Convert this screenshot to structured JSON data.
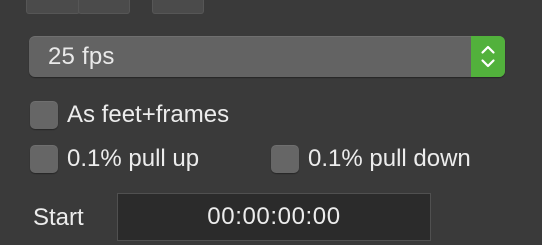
{
  "frame_rate": {
    "selected": "25 fps"
  },
  "options": {
    "feet_frames": {
      "label": "As feet+frames",
      "checked": false
    },
    "pull_up": {
      "label": "0.1% pull up",
      "checked": false
    },
    "pull_down": {
      "label": "0.1% pull down",
      "checked": false
    }
  },
  "start": {
    "label": "Start",
    "value": "00:00:00:00"
  },
  "icons": {
    "stepper": "chevron-up-down-icon"
  },
  "colors": {
    "panel_background": "#3a3a3a",
    "stepper_accent": "#52b13c",
    "field_background": "#2b2b2b",
    "text": "#ececec"
  }
}
